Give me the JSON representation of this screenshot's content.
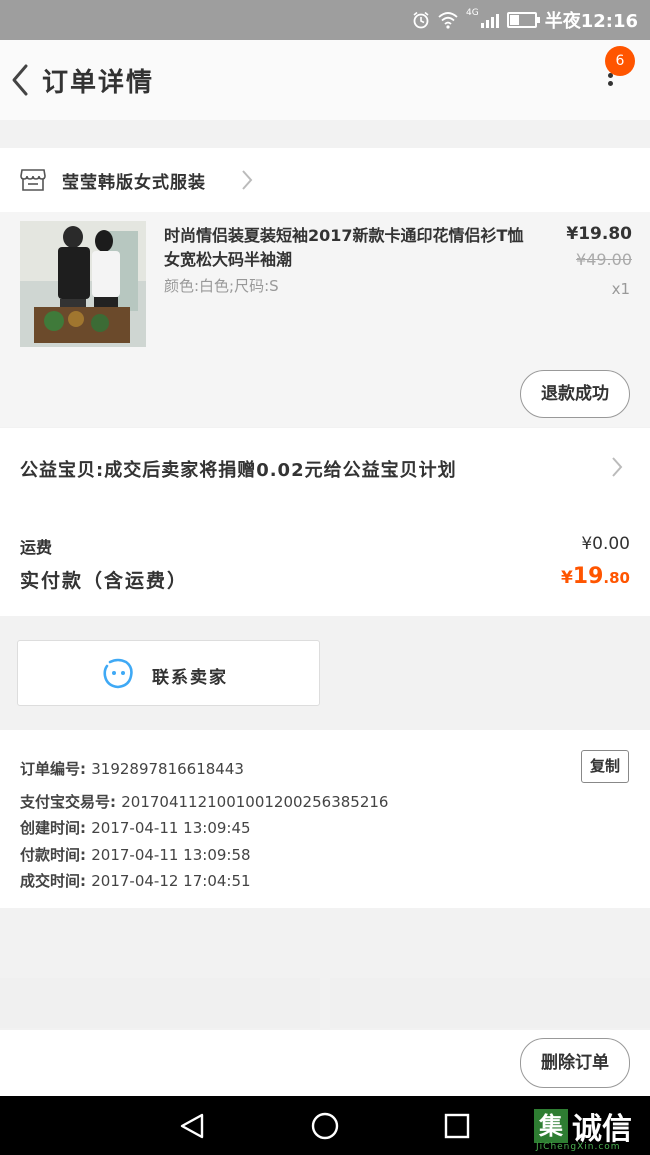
{
  "status_bar": {
    "network": "4G",
    "time": "半夜12:16",
    "battery_level": 0.35
  },
  "header": {
    "title": "订单详情",
    "badge_count": "6"
  },
  "shop": {
    "name": "莹莹韩版女式服装"
  },
  "item": {
    "title": "时尚情侣装夏装短袖2017新款卡通印花情侣衫T恤女宽松大码半袖潮",
    "sku": "颜色:白色;尺码:S",
    "price": "¥19.80",
    "original_price": "¥49.00",
    "quantity": "x1",
    "status_button": "退款成功"
  },
  "charity": {
    "text": "公益宝贝:成交后卖家将捐赠0.02元给公益宝贝计划"
  },
  "summary": {
    "shipping_label": "运费",
    "shipping_value": "¥0.00",
    "paid_label": "实付款（含运费）",
    "paid_symbol": "¥",
    "paid_integer": "19",
    "paid_decimal": ".80"
  },
  "contact": {
    "label": "联系卖家"
  },
  "order_info": {
    "order_no_label": "订单编号:",
    "order_no": "3192897816618443",
    "copy_label": "复制",
    "alipay_label": "支付宝交易号:",
    "alipay_no": "2017041121001001200256385216",
    "created_label": "创建时间:",
    "created": "2017-04-11 13:09:45",
    "paid_time_label": "付款时间:",
    "paid_time": "2017-04-11 13:09:58",
    "closed_label": "成交时间:",
    "closed": "2017-04-12 17:04:51"
  },
  "actions": {
    "delete_label": "删除订单"
  },
  "watermark": {
    "logo": "集",
    "text": "诚信",
    "sub": "JiChengXin.com"
  },
  "colors": {
    "accent": "#ff5500",
    "status_bar": "#9e9e9e",
    "contact_icon": "#3fa9f5"
  },
  "icons": [
    "alarm-icon",
    "wifi-icon",
    "signal-icon",
    "battery-icon",
    "back-icon",
    "more-icon",
    "shop-icon",
    "chevron-right-icon",
    "contact-seller-icon",
    "nav-back-icon",
    "nav-home-icon",
    "nav-recents-icon"
  ]
}
